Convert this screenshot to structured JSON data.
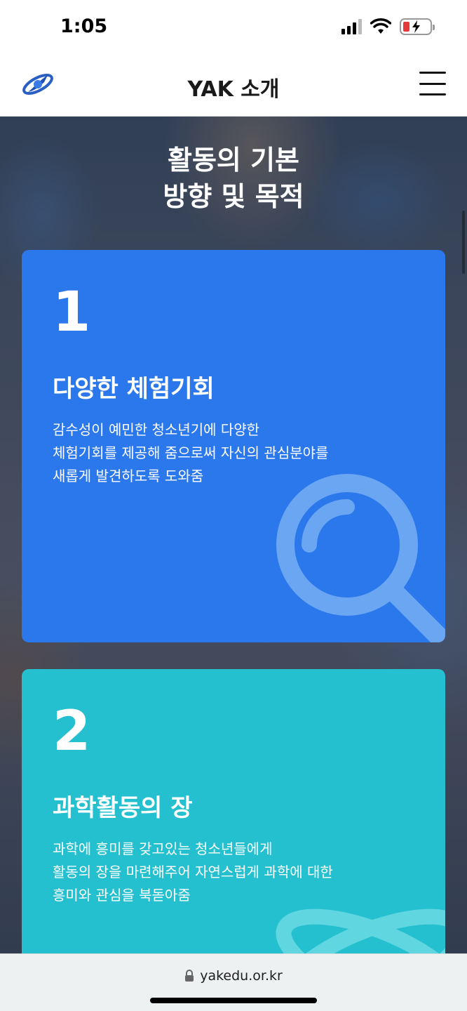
{
  "status_bar": {
    "time": "1:05"
  },
  "header": {
    "title": "YAK 소개"
  },
  "hero": {
    "title_line1": "활동의 기본",
    "title_line2": "방향 및 목적"
  },
  "cards": [
    {
      "number": "1",
      "heading": "다양한 체험기회",
      "desc": [
        "감수성이 예민한 청소년기에 다양한",
        "체험기회를 제공해 줌으로써 자신의 관심분야를",
        "새롭게 발견하도록 도와줌"
      ],
      "color": "#2b77ec",
      "icon": "magnifier-icon"
    },
    {
      "number": "2",
      "heading": "과학활동의 장",
      "desc": [
        "과학에 흥미를 갖고있는 청소년들에게",
        "활동의 장을 마련해주어 자연스럽게 과학에 대한",
        "흥미와 관심을 북돋아줌"
      ],
      "color": "#25c0d0",
      "icon": "atom-icon"
    }
  ],
  "browser": {
    "url": "yakedu.or.kr"
  },
  "icons": [
    "signal-icon",
    "wifi-icon",
    "battery-charging-icon",
    "logo-icon",
    "hamburger-menu-icon",
    "lock-icon"
  ]
}
